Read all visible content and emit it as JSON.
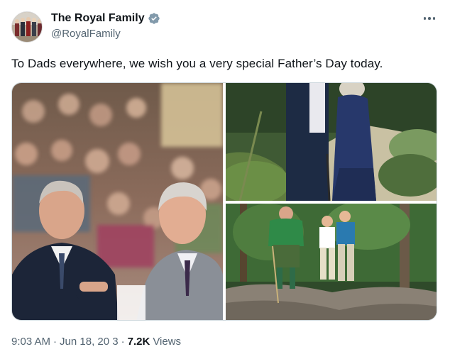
{
  "account": {
    "display_name": "The Royal Family",
    "handle": "@RoyalFamily",
    "verified": true,
    "avatar_icon": "royal-family-avatar"
  },
  "tweet": {
    "text": "To Dads everywhere, we wish you a very special Father’s Day today.",
    "time": "9:03 AM",
    "date": "Jun 18, 20  3",
    "separator": "·",
    "views_count": "7.2K",
    "views_label": "Views"
  },
  "media": {
    "photo_count": 3,
    "photos": [
      "photo-two-men-laughing",
      "photo-couple-in-garden",
      "photo-family-in-forest"
    ]
  },
  "colors": {
    "text_primary": "#0f1419",
    "text_secondary": "#536471",
    "verified_badge": "#829aab",
    "border": "#cfd9de"
  }
}
